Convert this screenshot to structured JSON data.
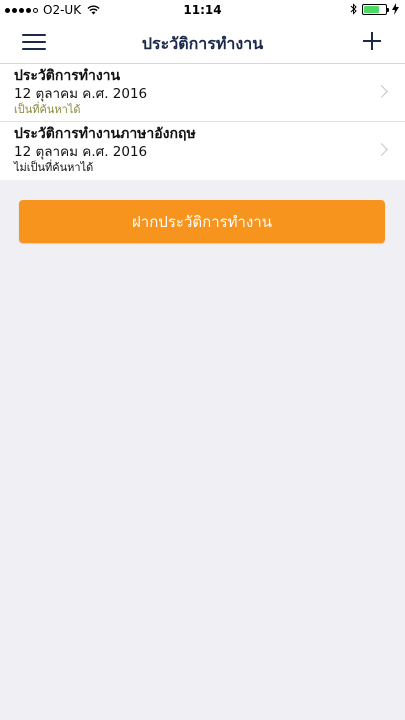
{
  "status_bar": {
    "carrier": "O2-UK",
    "time": "11:14",
    "battery_level": 0.7,
    "signal_bars_filled": 4
  },
  "nav": {
    "title": "ประวัติการทำงาน",
    "menu_icon": "hamburger-menu-icon",
    "add_icon": "plus-icon"
  },
  "list": {
    "items": [
      {
        "title": "ประวัติการทำงาน",
        "date": "12 ตุลาคม ค.ศ. 2016",
        "status": "เป็นที่ค้นหาได้"
      },
      {
        "title": "ประวัติการทำงานภาษาอังกฤษ",
        "date": "12 ตุลาคม ค.ศ. 2016",
        "status": "ไม่เป็นที่ค้นหาได้"
      }
    ]
  },
  "deposit_button": {
    "label": "ฝากประวัติการทำงาน"
  },
  "colors": {
    "accent": "#f7941d",
    "nav_text": "#1b2a4a",
    "searchable_status": "#8a8a3c",
    "background": "#efeff4"
  }
}
